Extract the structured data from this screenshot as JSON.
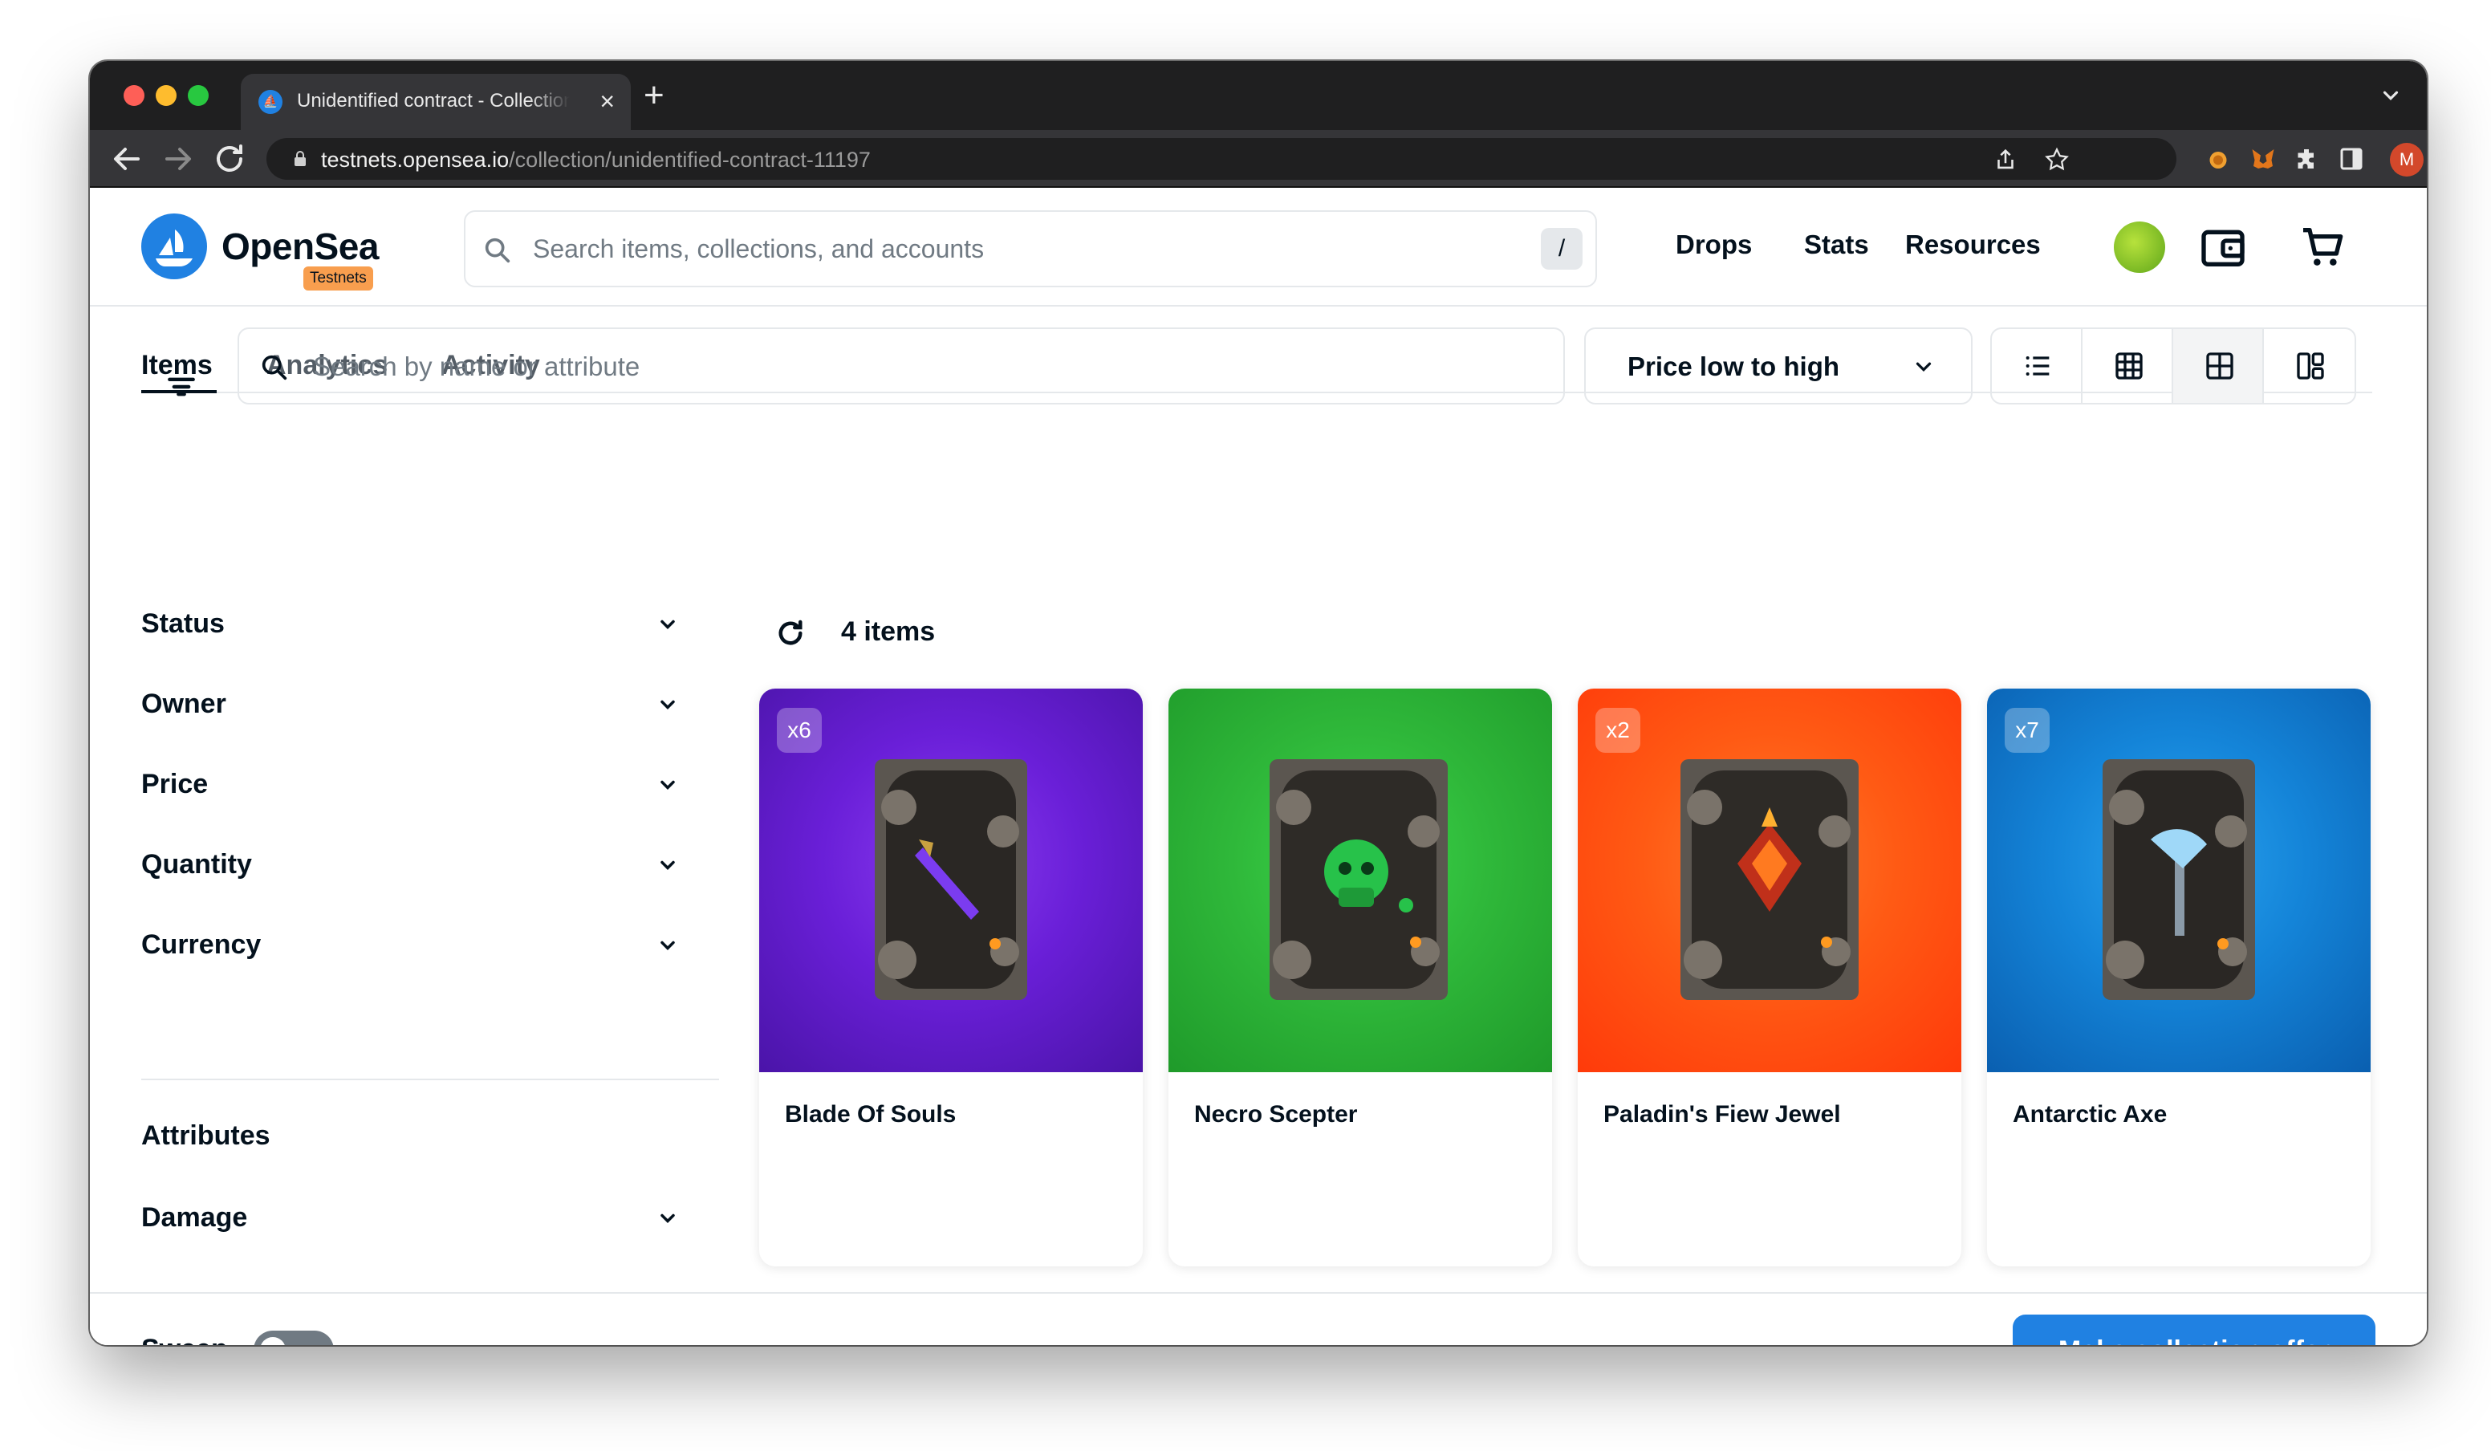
{
  "browser": {
    "tab_title": "Unidentified contract - Collection",
    "new_tab_symbol": "+",
    "close_symbol": "×",
    "url_host": "testnets.opensea.io",
    "url_path": "/collection/unidentified-contract-11197",
    "profile_initial": "M"
  },
  "header": {
    "logo_text": "OpenSea",
    "network_badge": "Testnets",
    "search_placeholder": "Search items, collections, and accounts",
    "search_shortcut": "/",
    "nav": [
      "Drops",
      "Stats",
      "Resources"
    ]
  },
  "tabs": [
    {
      "label": "Items",
      "active": true
    },
    {
      "label": "Analytics",
      "active": false
    },
    {
      "label": "Activity",
      "active": false
    }
  ],
  "toolbar": {
    "item_search_placeholder": "Search by name or attribute",
    "sort_selected": "Price low to high",
    "view_modes": [
      "list-view-icon",
      "small-grid-icon",
      "large-grid-icon",
      "mosaic-icon"
    ],
    "active_view": "large-grid-icon"
  },
  "sidebar": {
    "facets": [
      "Status",
      "Owner",
      "Price",
      "Quantity",
      "Currency"
    ],
    "attributes_heading": "Attributes",
    "attribute_facets": [
      "Damage"
    ]
  },
  "results": {
    "count_label": "4 items",
    "items": [
      {
        "name": "Blade Of Souls",
        "quantity": "x6",
        "bg_color": "#6a1fd8",
        "icon": "purple-sword-icon"
      },
      {
        "name": "Necro Scepter",
        "quantity": "",
        "bg_color": "#2fb83a",
        "icon": "green-skull-icon"
      },
      {
        "name": "Paladin's Fiew Jewel",
        "quantity": "x2",
        "bg_color": "#ff5a14",
        "icon": "fire-jewel-icon"
      },
      {
        "name": "Antarctic Axe",
        "quantity": "x7",
        "bg_color": "#1484d8",
        "icon": "ice-axe-icon"
      }
    ]
  },
  "footer": {
    "sweep_label": "Sweep",
    "sweep_enabled": false,
    "offer_button": "Make collection offer"
  },
  "colors": {
    "brand": "#2081e2",
    "text": "#04111d",
    "muted": "#707a83",
    "border": "#e5e8eb"
  }
}
